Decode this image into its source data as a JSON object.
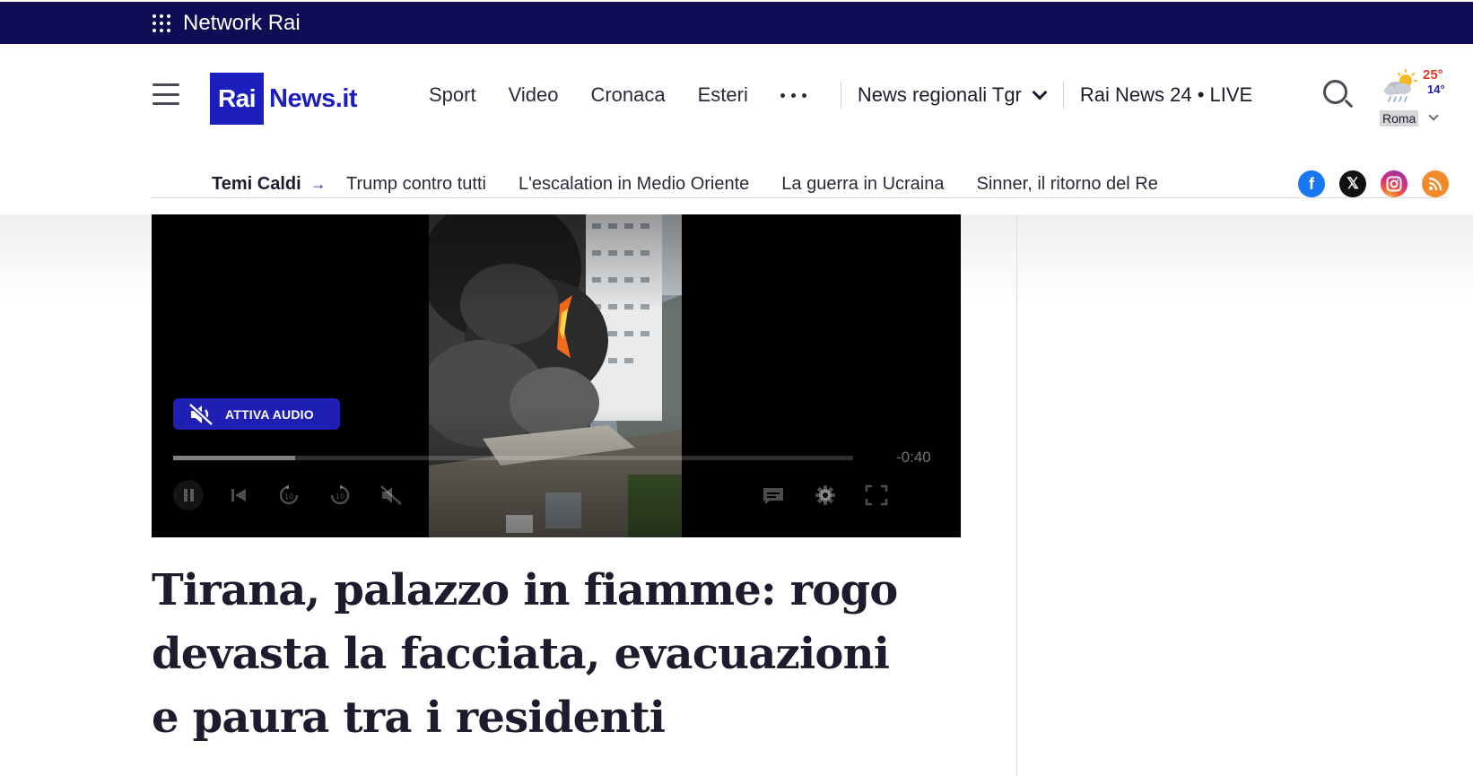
{
  "network": {
    "label": "Network Rai"
  },
  "logo": {
    "rai": "Rai",
    "news": "News.it"
  },
  "nav": {
    "items": [
      "Sport",
      "Video",
      "Cronaca",
      "Esteri"
    ],
    "regional": "News regionali Tgr",
    "live": "Rai News 24 • LIVE"
  },
  "weather": {
    "temp_max": "25°",
    "temp_min": "14°",
    "city": "Roma",
    "icon": "sun-cloud-rain-icon"
  },
  "hot_topics": {
    "title": "Temi Caldi",
    "links": [
      "Trump contro tutti",
      "L'escalation in Medio Oriente",
      "La guerra in Ucraina",
      "Sinner, il ritorno del Re"
    ]
  },
  "socials": [
    "facebook-icon",
    "x-icon",
    "instagram-icon",
    "rss-icon"
  ],
  "video": {
    "audio_button": "ATTIVA AUDIO",
    "time_remaining": "-0:40",
    "progress": 0.18
  },
  "article": {
    "headline": "Tirana, palazzo in fiamme: rogo devasta la facciata, evacuazioni e paura tra i residenti"
  },
  "colors": {
    "network_bar": "#0f0c56",
    "brand_blue": "#1d1ebe",
    "temp_max": "#e23b23"
  }
}
